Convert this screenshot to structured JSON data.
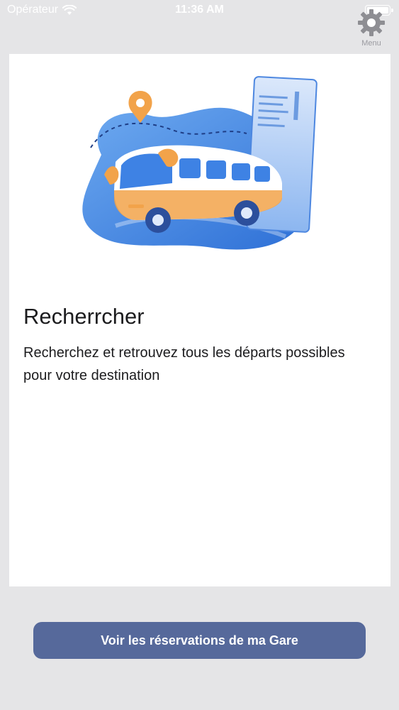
{
  "status_bar": {
    "carrier": "Opérateur",
    "time": "11:36 AM",
    "wifi_icon": "wifi-icon",
    "battery_icon": "battery-icon"
  },
  "header": {
    "menu_label": "Menu",
    "menu_icon": "gear-icon"
  },
  "card": {
    "illustration": "bus-illustration",
    "title": "Recherrcher",
    "description": "Recherchez et retrouvez tous les départs possibles pour votre destination"
  },
  "footer": {
    "button_label": "Voir les réservations de ma Gare"
  },
  "colors": {
    "background": "#e5e5e7",
    "card": "#ffffff",
    "button": "#56699b",
    "illustration_blue": "#4f8fe6",
    "illustration_orange": "#f2a34a"
  }
}
